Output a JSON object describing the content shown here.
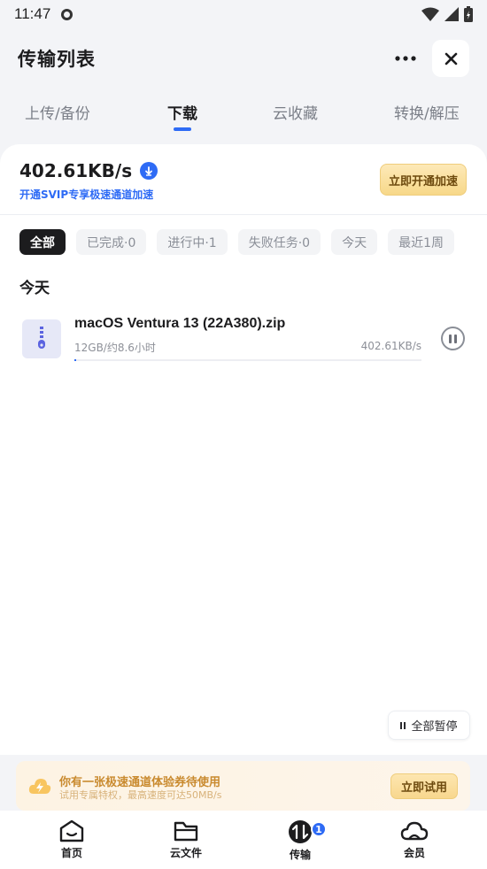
{
  "status_bar": {
    "time": "11:47"
  },
  "header": {
    "title": "传输列表"
  },
  "tabs": [
    {
      "label": "上传/备份",
      "active": false
    },
    {
      "label": "下载",
      "active": true
    },
    {
      "label": "云收藏",
      "active": false
    },
    {
      "label": "转换/解压",
      "active": false
    }
  ],
  "speed_panel": {
    "speed": "402.61KB/s",
    "svip_text": "开通SVIP专享极速通道加速",
    "accel_button": "立即开通加速"
  },
  "filters": [
    "全部",
    "已完成·0",
    "进行中·1",
    "失败任务·0",
    "今天",
    "最近1周"
  ],
  "section_title": "今天",
  "download": {
    "file_name": "macOS Ventura 13 (22A380).zip",
    "meta": "12GB/约8.6小时",
    "speed": "402.61KB/s",
    "progress": 0.005
  },
  "pause_all_label": "全部暂停",
  "promo": {
    "line1": "你有一张极速通道体验券待使用",
    "line2": "试用专属特权，最高速度可达50MB/s",
    "button": "立即试用"
  },
  "bottom_nav": [
    {
      "label": "首页",
      "icon": "home-icon"
    },
    {
      "label": "云文件",
      "icon": "folder-icon"
    },
    {
      "label": "传输",
      "icon": "transfer-icon",
      "badge": "1"
    },
    {
      "label": "会员",
      "icon": "cloud-icon"
    }
  ],
  "colors": {
    "accent": "#2e6bf5",
    "gold": "#f7d889"
  }
}
